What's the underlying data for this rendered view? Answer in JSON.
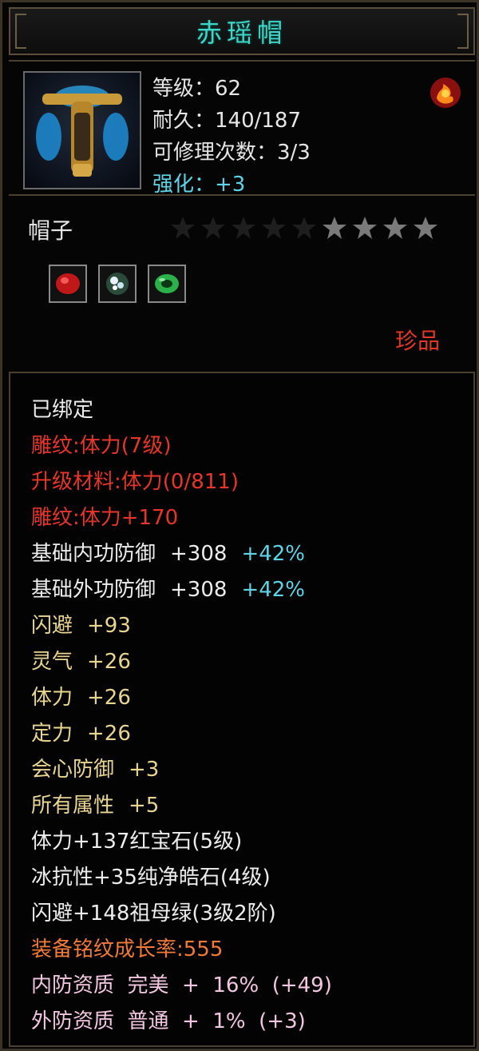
{
  "window": {
    "title": "赤瑶帽"
  },
  "item": {
    "icon_name": "hat-icon",
    "badge_icon": "fire-emblem-icon",
    "stats": [
      {
        "label": "等级：62",
        "color": "#e6e6e6"
      },
      {
        "label": "耐久：140/187",
        "color": "#e6e6e6"
      },
      {
        "label": "可修理次数：3/3",
        "color": "#e6e6e6"
      },
      {
        "label": "强化：+3",
        "color": "#5fd4e6"
      }
    ],
    "type": "帽子",
    "stars": {
      "filled": 5,
      "total": 9
    },
    "gems": [
      {
        "name": "ruby-gem-icon",
        "color": "#c01818"
      },
      {
        "name": "diamond-gem-icon",
        "color": "#c8e6f0"
      },
      {
        "name": "jade-gem-icon",
        "color": "#2cb04a"
      }
    ],
    "quality": "珍品"
  },
  "details": {
    "bound": "已绑定",
    "engraving": "雕纹:体力(7级)",
    "upgrade_material": "升级材料:体力(0/811)",
    "engraving_bonus": "雕纹:体力+170",
    "base_inner_def": {
      "label": "基础内功防御",
      "value": "+308",
      "pct": "+42%"
    },
    "base_outer_def": {
      "label": "基础外功防御",
      "value": "+308",
      "pct": "+42%"
    },
    "attributes": [
      {
        "label": "闪避",
        "value": "+93"
      },
      {
        "label": "灵气",
        "value": "+26"
      },
      {
        "label": "体力",
        "value": "+26"
      },
      {
        "label": "定力",
        "value": "+26"
      },
      {
        "label": "会心防御",
        "value": "+3"
      },
      {
        "label": "所有属性",
        "value": "+5"
      }
    ],
    "gem_bonuses": [
      "体力+137红宝石(5级)",
      "冰抗性+35纯净皓石(4级)",
      "闪避+148祖母绿(3级2阶)"
    ],
    "growth_rate": "装备铭纹成长率:555",
    "inner_quality": "内防资质  完美  +  16%  (+49)",
    "outer_quality": "外防资质  普通  +  1%  (+3)"
  },
  "colors": {
    "title": "#3fd6c8",
    "red": "#e6352b",
    "yellow": "#e7d591",
    "orange": "#ef7a3a",
    "pink": "#f2c6e0",
    "cyan": "#5fd4e6"
  }
}
